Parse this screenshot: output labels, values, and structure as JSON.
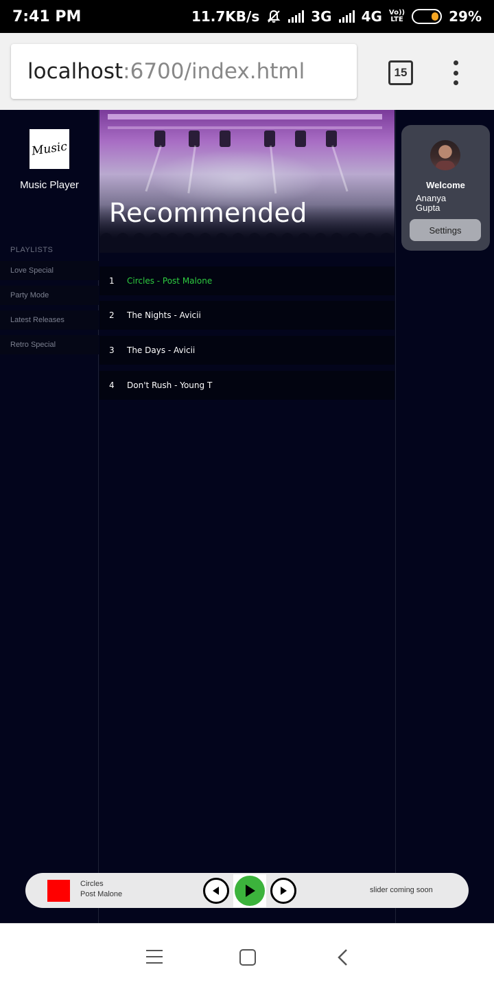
{
  "statusbar": {
    "time": "7:41 PM",
    "speed": "11.7KB/s",
    "net1": "3G",
    "net2": "4G",
    "volte_top": "Vo))",
    "volte_bottom": "LTE",
    "battery": "29%",
    "icons": [
      "muted-bell-icon",
      "signal-icon",
      "signal-icon",
      "battery-icon"
    ]
  },
  "browser": {
    "url_host": "localhost",
    "url_rest": ":6700/index.html",
    "tab_count": "15",
    "icons": [
      "tabs-icon",
      "kebab-menu-icon"
    ]
  },
  "sidebar": {
    "logo_text": "Music",
    "app_name": "Music Player",
    "playlists_header": "PLAYLISTS",
    "playlists": [
      {
        "label": "Love Special"
      },
      {
        "label": "Party Mode"
      },
      {
        "label": "Latest Releases"
      },
      {
        "label": "Retro Special"
      }
    ]
  },
  "main": {
    "hero_title": "Recommended",
    "tracks": [
      {
        "num": "1",
        "title": "Circles - Post Malone",
        "active": true
      },
      {
        "num": "2",
        "title": "The Nights - Avicii",
        "active": false
      },
      {
        "num": "3",
        "title": "The Days - Avicii",
        "active": false
      },
      {
        "num": "4",
        "title": "Don't Rush - Young T",
        "active": false
      }
    ],
    "active_color": "#2ecc40"
  },
  "profile": {
    "welcome": "Welcome",
    "first_name": "Ananya",
    "last_name": "Gupta",
    "settings_label": "Settings"
  },
  "player": {
    "now_playing_title": "Circles",
    "now_playing_artist": "Post Malone",
    "slider_text": "slider coming soon",
    "cover_color": "#ff0000",
    "play_color": "#3cb33c",
    "icons": [
      "previous-icon",
      "play-icon",
      "next-icon"
    ]
  },
  "navbar": {
    "icons": [
      "menu-icon",
      "home-icon",
      "back-icon"
    ]
  }
}
